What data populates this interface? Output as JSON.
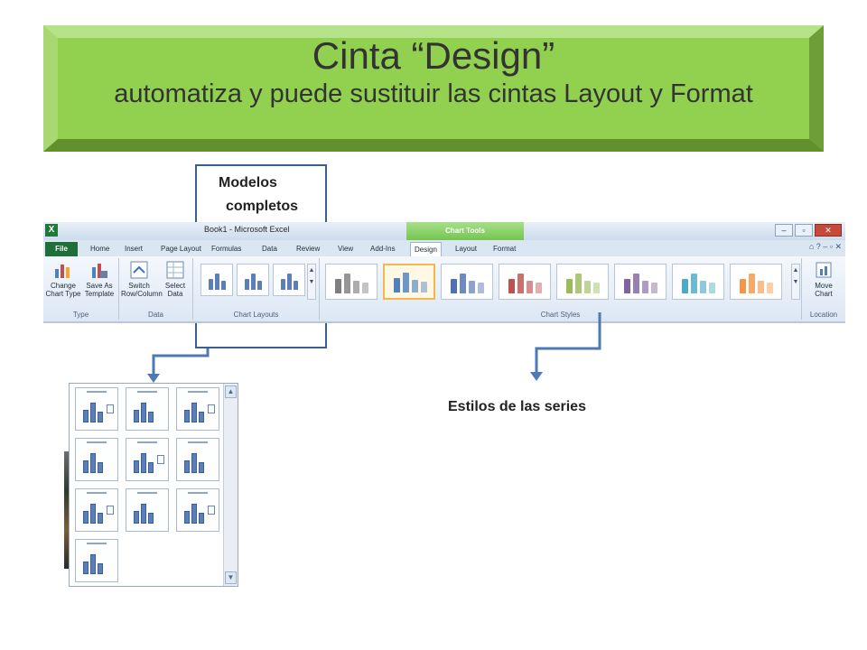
{
  "banner": {
    "title": "Cinta “Design”",
    "subtitle": "automatiza y puede sustituir las cintas Layout y Format"
  },
  "annotations": {
    "modelos_line1": "Modelos",
    "modelos_line2": "completos",
    "estilos": "Estilos de las series"
  },
  "excel": {
    "app_icon": "X",
    "window_title": "Book1 - Microsoft Excel",
    "context_tab": "Chart Tools",
    "tabs": [
      "File",
      "Home",
      "Insert",
      "Page Layout",
      "Formulas",
      "Data",
      "Review",
      "View",
      "Add-Ins",
      "Design",
      "Layout",
      "Format"
    ],
    "active_tab": "Design",
    "buttons": {
      "change_chart_type": "Change Chart Type",
      "save_as_template": "Save As Template",
      "switch_row_column": "Switch Row/Column",
      "select_data": "Select Data",
      "move_chart": "Move Chart"
    },
    "groups": {
      "type": "Type",
      "data": "Data",
      "chart_layouts": "Chart Layouts",
      "chart_styles": "Chart Styles",
      "location": "Location"
    },
    "style_colors": [
      "#7f7f7f",
      "#4f81bd",
      "#4f6fb5",
      "#c0504d",
      "#9bbb59",
      "#8064a2",
      "#4bacc6",
      "#f79646"
    ],
    "selected_style": 1
  },
  "gallery": {
    "layout_count": 10
  }
}
